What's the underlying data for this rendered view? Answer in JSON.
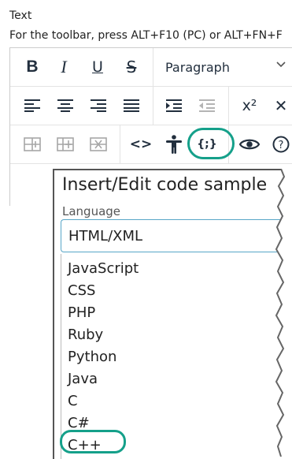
{
  "field_label": "Text",
  "hint": "For the toolbar, press ALT+F10 (PC) or ALT+FN+F",
  "toolbar": {
    "bold_glyph": "B",
    "italic_glyph": "I",
    "underline_glyph": "U",
    "strikethrough_glyph": "S",
    "block_format": "Paragraph",
    "superscript_glyph": "x²",
    "code_glyph": "<>",
    "codesample_glyph": "{;}"
  },
  "dialog": {
    "title": "Insert/Edit code sample",
    "language_label": "Language",
    "selected": "HTML/XML",
    "options": [
      "JavaScript",
      "CSS",
      "PHP",
      "Ruby",
      "Python",
      "Java",
      "C",
      "C#",
      "C++"
    ]
  },
  "colors": {
    "highlight": "#15a08a",
    "select_border": "#58a6c8",
    "text": "#222f3e"
  },
  "icons": [
    "bold-icon",
    "italic-icon",
    "underline-icon",
    "strikethrough-icon",
    "align-left-icon",
    "align-center-icon",
    "align-right-icon",
    "justify-icon",
    "indent-icon",
    "outdent-icon",
    "superscript-icon",
    "clear-format-icon",
    "table-insert-icon",
    "table-column-icon",
    "table-delete-icon",
    "source-code-icon",
    "accessibility-icon",
    "code-sample-icon",
    "preview-icon",
    "help-icon"
  ]
}
